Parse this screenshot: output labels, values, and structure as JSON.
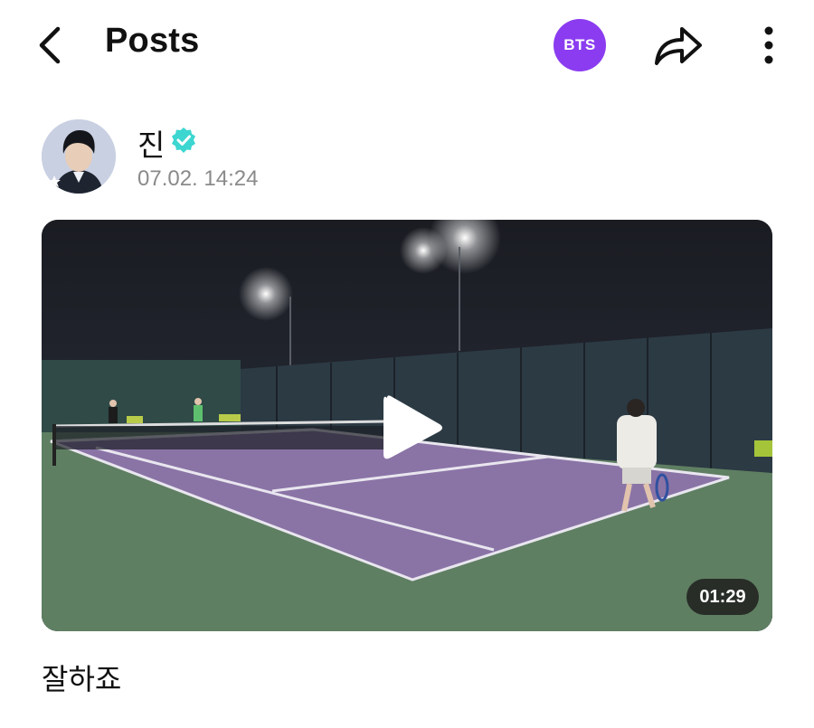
{
  "header": {
    "title": "Posts",
    "community_badge": "BTS",
    "icons": {
      "back": "chevron-left-icon",
      "share": "share-icon",
      "more": "more-vertical-icon"
    }
  },
  "post": {
    "author": "진",
    "verified": true,
    "timestamp": "07.02. 14:24",
    "video": {
      "duration": "01:29"
    },
    "caption": "잘하죠"
  },
  "colors": {
    "badge_purple": "#8b3cf0",
    "verified_teal": "#3dd6d0",
    "court_purple": "#8a74a6",
    "court_green": "#5f7f62",
    "timestamp_gray": "#8a8a8a"
  }
}
